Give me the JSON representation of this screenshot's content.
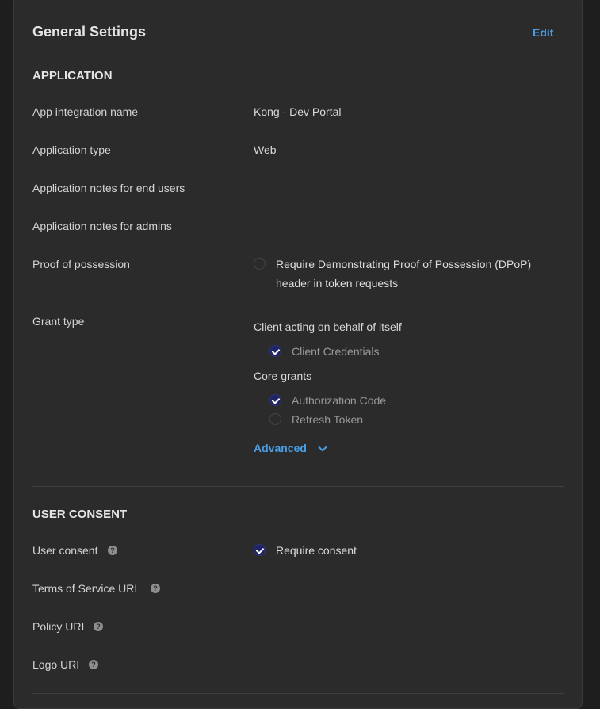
{
  "header": {
    "title": "General Settings",
    "edit_label": "Edit"
  },
  "application": {
    "section_title": "APPLICATION",
    "app_integration_name": {
      "label": "App integration name",
      "value": "Kong - Dev Portal"
    },
    "application_type": {
      "label": "Application type",
      "value": "Web"
    },
    "notes_end_users": {
      "label": "Application notes for end users",
      "value": ""
    },
    "notes_admins": {
      "label": "Application notes for admins",
      "value": ""
    },
    "proof_of_possession": {
      "label": "Proof of possession",
      "option_line1": "Require Demonstrating Proof of Possession (DPoP)",
      "option_line2": "header in token requests",
      "checked": false
    },
    "grant_type": {
      "label": "Grant type",
      "client_heading": "Client acting on behalf of itself",
      "client_credentials": {
        "label": "Client Credentials",
        "checked": true
      },
      "core_heading": "Core grants",
      "authorization_code": {
        "label": "Authorization Code",
        "checked": true
      },
      "refresh_token": {
        "label": "Refresh Token",
        "checked": false
      },
      "advanced_label": "Advanced"
    }
  },
  "user_consent": {
    "section_title": "USER CONSENT",
    "user_consent": {
      "label": "User consent",
      "option": "Require consent",
      "checked": true
    },
    "terms_of_service_uri": {
      "label": "Terms of Service URI"
    },
    "policy_uri": {
      "label": "Policy URI"
    },
    "logo_uri": {
      "label": "Logo URI"
    }
  },
  "colors": {
    "accent": "#4a9fe6",
    "checkbox_fill": "#1f2468",
    "panel": "#2b2b2b"
  }
}
